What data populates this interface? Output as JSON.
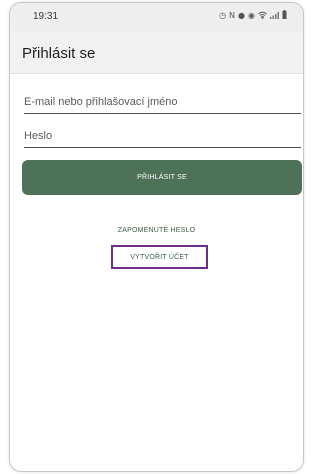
{
  "status_bar": {
    "time": "19:31",
    "icons": [
      "alarm-icon",
      "nfc-icon",
      "location-icon",
      "wifi-icon",
      "signal-icon",
      "battery-icon"
    ]
  },
  "app_bar": {
    "title": "Přihlásit se"
  },
  "form": {
    "email_placeholder": "E-mail nebo přihlašovací jméno",
    "password_placeholder": "Heslo",
    "login_label": "PŘIHLÁSIT SE",
    "forgot_label": "ZAPOMENUTÉ HESLO",
    "create_label": "VYTVOŘIT ÚČET"
  },
  "colors": {
    "primary": "#4e7258",
    "link": "#3e5b46",
    "highlight": "#6b2f87",
    "app_bar": "#f1f1f1"
  }
}
